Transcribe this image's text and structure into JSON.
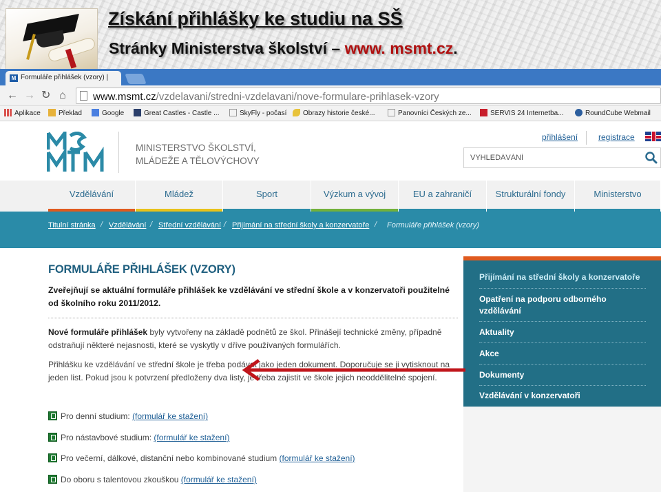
{
  "slide": {
    "title": "Získání přihlášky ke studiu na SŠ",
    "subtitle_prefix": "Stránky Ministerstva školství – ",
    "subtitle_url": "www. msmt.cz",
    "subtitle_suffix": "."
  },
  "browser": {
    "tab_title": "Formuláře přihlášek (vzory) |",
    "tab_favicon": "M",
    "url_host": "www.msmt.cz",
    "url_path": "/vzdelavani/stredni-vzdelavani/nove-formulare-prihlasek-vzory",
    "bookmarks": [
      {
        "label": "Aplikace",
        "icon": "apps-grid-icon",
        "color": "#d9534f"
      },
      {
        "label": "Překlad",
        "icon": "folder-icon",
        "color": "#e7b23a"
      },
      {
        "label": "Google",
        "icon": "google-icon",
        "color": "#4a7fe0"
      },
      {
        "label": "Great Castles - Castle ...",
        "icon": "castle-icon",
        "color": "#2b3f6b"
      },
      {
        "label": "SkyFly - počasí",
        "icon": "page-icon",
        "color": "#999999"
      },
      {
        "label": "Obrazy historie české...",
        "icon": "leaf-icon",
        "color": "#e8c33a"
      },
      {
        "label": "Panovníci Českých ze...",
        "icon": "page-icon",
        "color": "#999999"
      },
      {
        "label": "SERVIS 24 Internetba...",
        "icon": "servis24-icon",
        "color": "#c81e2b"
      },
      {
        "label": "RoundCube Webmail",
        "icon": "roundcube-icon",
        "color": "#2c5e9e"
      }
    ]
  },
  "site": {
    "logo_text": "MŠMT",
    "ministry_line1": "MINISTERSTVO ŠKOLSTVÍ,",
    "ministry_line2": "MLÁDEŽE A TĚLOVÝCHOVY",
    "login_label": "přihlášení",
    "register_label": "registrace",
    "search_placeholder": "VYHLEDÁVÁNÍ",
    "nav": [
      {
        "label": "Vzdělávání",
        "stripe": "#e05a1e"
      },
      {
        "label": "Mládež",
        "stripe": "#e8c21a"
      },
      {
        "label": "Sport",
        "stripe": "#2a8ba8"
      },
      {
        "label": "Výzkum a vývoj",
        "stripe": "#72b13b"
      },
      {
        "label": "EU a zahraničí",
        "stripe": "#2a8ba8"
      },
      {
        "label": "Strukturální fondy",
        "stripe": "#2a8ba8"
      },
      {
        "label": "Ministerstvo",
        "stripe": "#2a8ba8"
      }
    ],
    "breadcrumb": [
      "Titulní stránka",
      "Vzdělávání",
      "Střední vzdělávání",
      "Přijímání na střední školy a konzervatoře",
      "Formuláře přihlášek (vzory)"
    ],
    "breadcrumb_separator": "/",
    "heading": "FORMULÁŘE PŘIHLÁŠEK (VZORY)",
    "intro": "Zveřejňují se aktuální formuláře přihlášek ke vzdělávání ve střední škole a v konzervatoři použitelné od školního roku 2011/2012.",
    "para1_bold": "Nové formuláře přihlášek",
    "para1_rest": "  byly vytvořeny na základě podnětů ze škol. Přinášejí technické změny, případně odstraňují některé nejasnosti, které se vyskytly v dříve používaných formulářích.",
    "para2": "Přihlášku ke vzdělávání ve střední škole je třeba podávat jako jeden dokument. Doporučuje se ji vytisknout na jeden list. Pokud jsou k potvrzení předloženy dva listy, je třeba zajistit ve škole jejich neoddělitelné spojení.",
    "forms": [
      {
        "label": "Pro denní studium: ",
        "link": "(formulář ke stažení)"
      },
      {
        "label": "Pro nástavbové studium: ",
        "link": "(formulář ke stažení)"
      },
      {
        "label": "Pro večerní, dálkové, distanční nebo kombinované studium ",
        "link": "(formulář ke stažení)"
      },
      {
        "label": "Do oboru s talentovou zkouškou ",
        "link": "(formulář ke stažení)"
      }
    ],
    "sidebar": [
      "Přijímání na střední školy a konzervatoře",
      "Opatření na podporu odborného vzdělávání",
      "Aktuality",
      "Akce",
      "Dokumenty",
      "Vzdělávání v konzervatoři"
    ],
    "colors": {
      "teal": "#2a8ba8",
      "sidebar": "#226f86",
      "accent_orange": "#e05a1e",
      "arrow_red": "#c0161b"
    }
  }
}
